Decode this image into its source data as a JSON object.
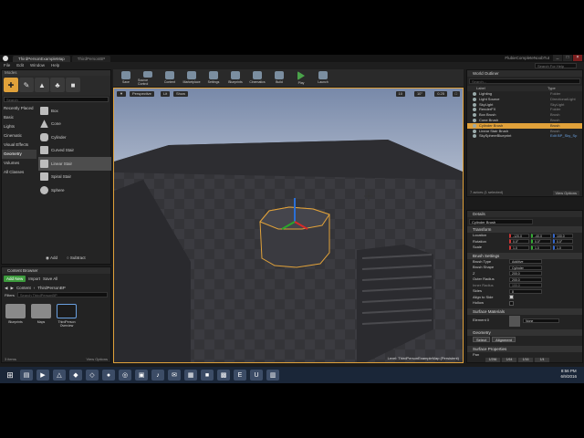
{
  "window": {
    "tabs": [
      "ThirdPersonExampleMap",
      "ThirdPersonBP"
    ],
    "project": "FlubieCompleteNoobTut",
    "buttons": [
      "_",
      "□",
      "×"
    ]
  },
  "menu": [
    "File",
    "Edit",
    "Window",
    "Help"
  ],
  "search_help": "Search For Help",
  "modes": {
    "title": "Modes",
    "search_placeholder": "Search",
    "categories": [
      "Recently Placed",
      "Basic",
      "Lights",
      "Cinematic",
      "Visual Effects",
      "Geometry",
      "Volumes",
      "All Classes"
    ],
    "selected_category": "Geometry",
    "shapes": [
      "Box",
      "Cone",
      "Cylinder",
      "Curved Stair",
      "Linear Stair",
      "Spiral Stair",
      "Sphere"
    ],
    "selected_shape": "Linear Stair",
    "add_label": "Add",
    "subtract_label": "Subtract"
  },
  "toolbar": {
    "buttons": [
      "Save",
      "Source Control",
      "Content",
      "Marketplace",
      "Settings",
      "Blueprints",
      "Cinematics",
      "Build",
      "Play",
      "Launch"
    ]
  },
  "viewport": {
    "perspective": "Perspective",
    "lit": "Lit",
    "show": "Show",
    "snap_grid": "10",
    "snap_rot": "10°",
    "snap_scale": "0.25",
    "level_label": "Level: ThirdPersonExampleMap (Persistent)"
  },
  "outliner": {
    "title": "World Outliner",
    "search_placeholder": "Search...",
    "col_label": "Label",
    "col_type": "Type",
    "rows": [
      {
        "label": "Lighting",
        "type": "Folder"
      },
      {
        "label": "Light Source",
        "type": "DirectionalLight"
      },
      {
        "label": "SkyLight",
        "type": "SkyLight"
      },
      {
        "label": "RenderFX",
        "type": "Folder"
      },
      {
        "label": "Box Brush",
        "type": "Brush"
      },
      {
        "label": "Cone Brush",
        "type": "Brush"
      },
      {
        "label": "Cylinder Brush",
        "type": "Brush"
      },
      {
        "label": "Linear Stair Brush",
        "type": "Brush"
      },
      {
        "label": "SkySphereBlueprint",
        "type": "Edit BP_Sky_Sp"
      }
    ],
    "selected_row": "Cylinder Brush",
    "footer": "7 actors (1 selected)",
    "view_options": "View Options"
  },
  "details": {
    "title": "Details",
    "name_field": "Cylinder Brush",
    "transform": {
      "header": "Transform",
      "location_label": "Location",
      "location": [
        "-120.0",
        "-40.0",
        "100.0"
      ],
      "rotation_label": "Rotation",
      "rotation": [
        "0.0°",
        "0.0°",
        "0.0°"
      ],
      "scale_label": "Scale",
      "scale": [
        "1.0",
        "1.0",
        "1.0"
      ]
    },
    "brush": {
      "header": "Brush Settings",
      "brush_type_label": "Brush Type",
      "brush_type": "Additive",
      "brush_shape_label": "Brush Shape",
      "brush_shape": "Cylinder",
      "z_label": "Z",
      "z": "200.0",
      "outer_radius_label": "Outer Radius",
      "outer_radius": "200.0",
      "inner_radius_label": "Inner Radius",
      "inner_radius": "100.0",
      "sides_label": "Sides",
      "sides": "8",
      "align_label": "Align to Side",
      "hollow_label": "Hollow"
    },
    "materials": {
      "header": "Surface Materials",
      "element_label": "Element 0",
      "material": "None"
    },
    "geometry": {
      "header": "Geometry",
      "select_label": "Select",
      "alignment_label": "Alignment"
    },
    "surface": {
      "header": "Surface Properties",
      "pan_label": "Pan",
      "pan_values": [
        "1/256",
        "1/64",
        "1/16",
        "1/4"
      ]
    }
  },
  "content_browser": {
    "title": "Content Browser",
    "add_new": "Add New",
    "import": "Import",
    "save_all": "Save All",
    "path_root": "Content",
    "path_leaf": "ThirdPersonBP",
    "filters_label": "Filters",
    "search_placeholder": "Search ThirdPersonBP",
    "assets": [
      "Blueprints",
      "Maps",
      "ThirdPerson Overview"
    ],
    "item_count": "3 items",
    "view_options": "View Options"
  },
  "taskbar": {
    "time": "8:56 PM",
    "date": "6/9/2016"
  }
}
